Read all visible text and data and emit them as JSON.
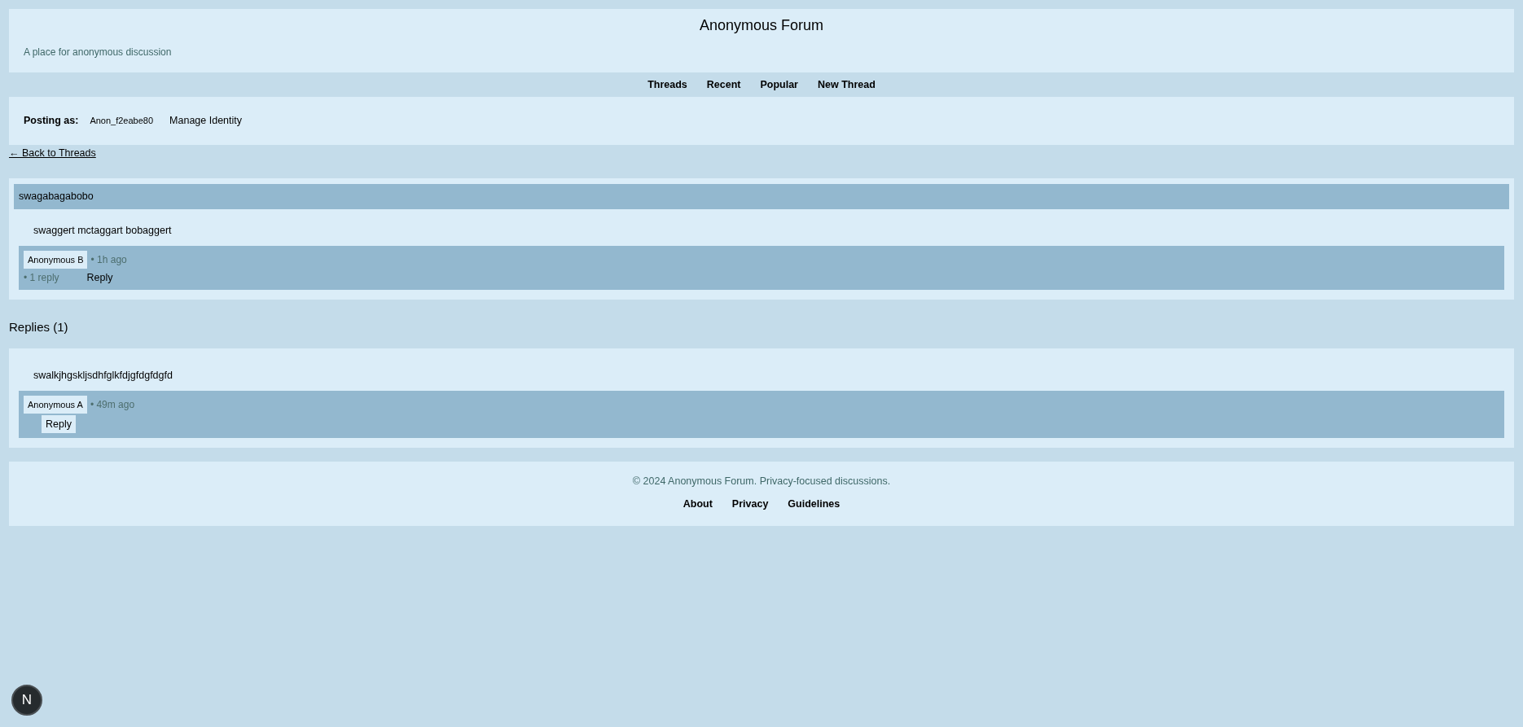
{
  "header": {
    "title": "Anonymous Forum",
    "tagline": "A place for anonymous discussion"
  },
  "nav": [
    "Threads",
    "Recent",
    "Popular",
    "New Thread"
  ],
  "identity": {
    "label": "Posting as:",
    "name": "Anon_f2eabe80",
    "action": "Manage Identity"
  },
  "back_link": "← Back to Threads",
  "thread": {
    "title": "swagabagabobo",
    "body": "swaggert mctaggart bobaggert",
    "author": "Anonymous B",
    "time": "• 1h ago",
    "reply_count": "• 1 reply",
    "reply_button": "Reply"
  },
  "replies_heading": "Replies (1)",
  "replies": [
    {
      "body": "swalkjhgskljsdhfglkfdjgfdgfdgfd",
      "author": "Anonymous A",
      "time": "• 49m ago",
      "reply_button": "Reply"
    }
  ],
  "footer": {
    "text": "© 2024 Anonymous Forum. Privacy-focused discussions.",
    "links": [
      "About",
      "Privacy",
      "Guidelines"
    ]
  },
  "dev_badge": {
    "letter": "N"
  }
}
